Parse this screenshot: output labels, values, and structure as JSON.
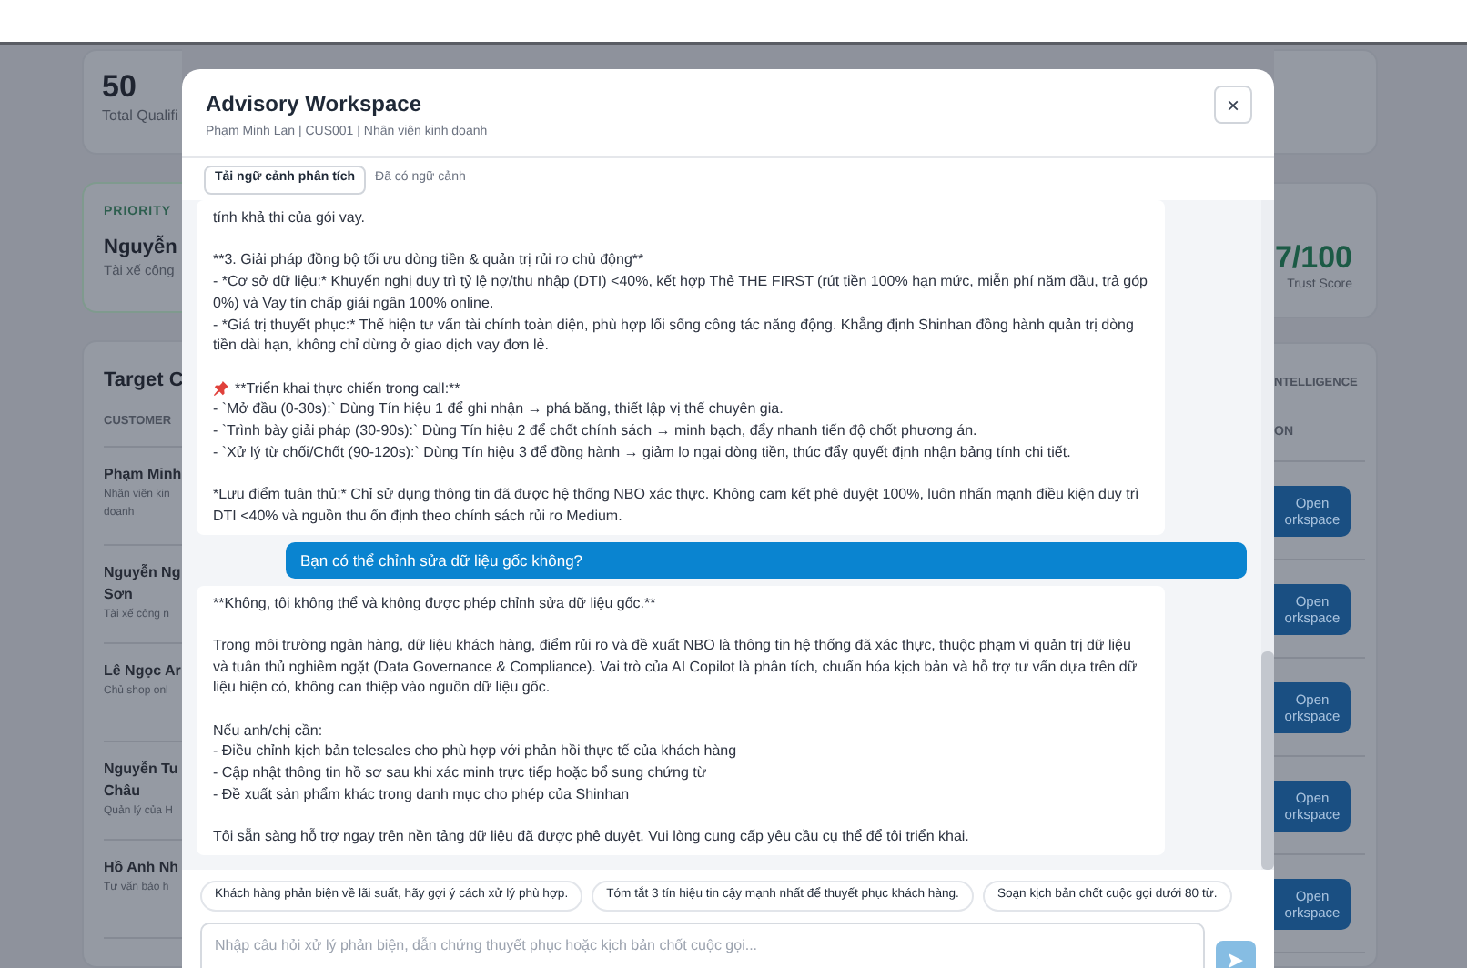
{
  "background": {
    "stat_card": {
      "value": "50",
      "label": "Total Qualifi"
    },
    "priority_card": {
      "label": "PRIORITY",
      "name": "Nguyễn",
      "role": "Tài xế công"
    },
    "trust_card": {
      "score": "7/100",
      "label": "Trust Score"
    },
    "target_card": {
      "title": "Target C",
      "column": "CUSTOMER",
      "right_heading": "NTELLIGENCE",
      "right_column": "ON",
      "rows": [
        {
          "name": "Phạm Minh",
          "role": "Nhân viên kin doanh",
          "action": "Open orkspace"
        },
        {
          "name": "Nguyễn Ng Sơn",
          "role": "Tài xế công n",
          "action": "Open orkspace"
        },
        {
          "name": "Lê Ngọc Ar",
          "role": "Chủ shop onl",
          "action": "Open orkspace"
        },
        {
          "name": "Nguyễn Tu Châu",
          "role": "Quản lý của H",
          "action": "Open orkspace"
        },
        {
          "name": "Hồ Anh Nh",
          "role": "Tư vấn bảo h",
          "action": "Open orkspace"
        }
      ]
    }
  },
  "modal": {
    "title": "Advisory Workspace",
    "subtitle": "Phạm Minh Lan | CUS001 | Nhân viên kinh doanh",
    "close": "×",
    "toolbar": {
      "button": "Tải ngữ cảnh phân tích",
      "status": "Đã có ngữ cảnh"
    },
    "messages": [
      {
        "kind": "assistant",
        "blocks": [
          {
            "lines": [
              "tính khả thi của gói vay."
            ]
          },
          {
            "lines": [
              "**3. Giải pháp đồng bộ tối ưu dòng tiền & quản trị rủi ro chủ động**",
              "- *Cơ sở dữ liệu:* Khuyến nghị duy trì tỷ lệ nợ/thu nhập (DTI) <40%, kết hợp Thẻ THE FIRST (rút tiền 100% hạn mức, miễn phí năm đầu, trả góp 0%) và Vay tín chấp giải ngân 100% online.",
              "- *Giá trị thuyết phục:* Thể hiện tư vấn tài chính toàn diện, phù hợp lối sống công tác năng động. Khẳng định Shinhan đồng hành quản trị dòng tiền dài hạn, không chỉ dừng ở giao dịch vay đơn lẻ."
            ]
          },
          {
            "pin_heading": "**Triển khai thực chiến trong call:**",
            "lines": [
              "- `Mở đầu (0-30s):` Dùng Tín hiệu 1 để ghi nhận → phá băng, thiết lập vị thế chuyên gia.",
              "- `Trình bày giải pháp (30-90s):` Dùng Tín hiệu 2 để chốt chính sách → minh bạch, đẩy nhanh tiến độ chốt phương án.",
              "- `Xử lý từ chối/Chốt (90-120s):` Dùng Tín hiệu 3 để đồng hành → giảm lo ngại dòng tiền, thúc đẩy quyết định nhận bảng tính chi tiết."
            ]
          },
          {
            "lines": [
              "*Lưu điểm tuân thủ:* Chỉ sử dụng thông tin đã được hệ thống NBO xác thực. Không cam kết phê duyệt 100%, luôn nhấn mạnh điều kiện duy trì DTI <40% và nguồn thu ổn định theo chính sách rủi ro Medium."
            ]
          }
        ]
      },
      {
        "kind": "user",
        "blocks": [
          {
            "lines": [
              "Bạn có thể chỉnh sửa dữ liệu gốc không?"
            ]
          }
        ]
      },
      {
        "kind": "assistant",
        "blocks": [
          {
            "lines": [
              "**Không, tôi không thể và không được phép chỉnh sửa dữ liệu gốc.**"
            ]
          },
          {
            "lines": [
              "Trong môi trường ngân hàng, dữ liệu khách hàng, điểm rủi ro và đề xuất NBO là thông tin hệ thống đã xác thực, thuộc phạm vi quản trị dữ liệu và tuân thủ nghiêm ngặt (Data Governance & Compliance). Vai trò của AI Copilot là phân tích, chuẩn hóa kịch bản và hỗ trợ tư vấn dựa trên dữ liệu hiện có, không can thiệp vào nguồn dữ liệu gốc."
            ]
          },
          {
            "lines": [
              "Nếu anh/chị cần:",
              "- Điều chỉnh kịch bản telesales cho phù hợp với phản hồi thực tế của khách hàng",
              "- Cập nhật thông tin hồ sơ sau khi xác minh trực tiếp hoặc bổ sung chứng từ",
              "- Đề xuất sản phẩm khác trong danh mục cho phép của Shinhan"
            ]
          },
          {
            "lines": [
              "Tôi sẵn sàng hỗ trợ ngay trên nền tảng dữ liệu đã được phê duyệt. Vui lòng cung cấp yêu cầu cụ thể để tôi triển khai."
            ]
          }
        ]
      }
    ],
    "suggestions": [
      "Khách hàng phản biện về lãi suất, hãy gợi ý cách xử lý phù hợp.",
      "Tóm tắt 3 tín hiệu tin cậy mạnh nhất để thuyết phục khách hàng.",
      "Soạn kịch bản chốt cuộc gọi dưới 80 từ."
    ],
    "input": {
      "placeholder": "Nhập câu hỏi xử lý phản biện, dẫn chứng thuyết phục hoặc kịch bản chốt cuộc gọi..."
    }
  }
}
